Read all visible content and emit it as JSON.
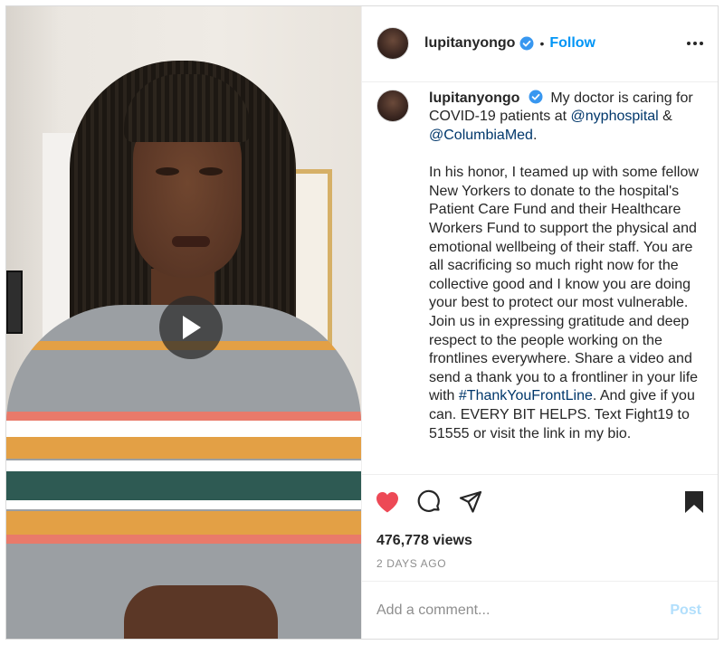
{
  "post": {
    "username": "lupitanyongo",
    "separator": "•",
    "follow_label": "Follow",
    "caption": {
      "line_start": "My doctor is caring for COVID-19 patients at",
      "mention_1": "@nyphospital",
      "amp": "&",
      "mention_2": "@ColumbiaMed",
      "after_mentions": ".",
      "paragraph_2a": "In his honor, I teamed up with some fellow New Yorkers to donate to the hospital's Patient Care Fund and their Healthcare Workers Fund to support the physical and emotional wellbeing of their staff. You are all sacrificing so much right now for the collective good and I know you are doing your best to protect our most vulnerable. Join us in expressing gratitude and deep respect to the people working on the frontlines everywhere. Share a video and send a thank you to a frontliner in your life with",
      "hashtag": "#ThankYouFrontLine",
      "paragraph_2b": ". And give if you can. EVERY BIT HELPS. Text Fight19 to 51555 or visit the link in my bio."
    },
    "views": "476,778 views",
    "timestamp": "2 DAYS AGO",
    "comment_placeholder": "Add a comment...",
    "post_label": "Post"
  },
  "colors": {
    "like_red": "#ed4956",
    "link_blue": "#00376b",
    "follow_blue": "#0095f6",
    "verified_blue": "#3897f0",
    "post_disabled": "#b2dffc"
  },
  "icons": {
    "media": "play-icon",
    "header_more": "more-options-icon",
    "verified": "verified-badge-icon",
    "like": "heart-filled-icon",
    "comment": "comment-icon",
    "share": "share-icon",
    "save": "bookmark-filled-icon"
  }
}
